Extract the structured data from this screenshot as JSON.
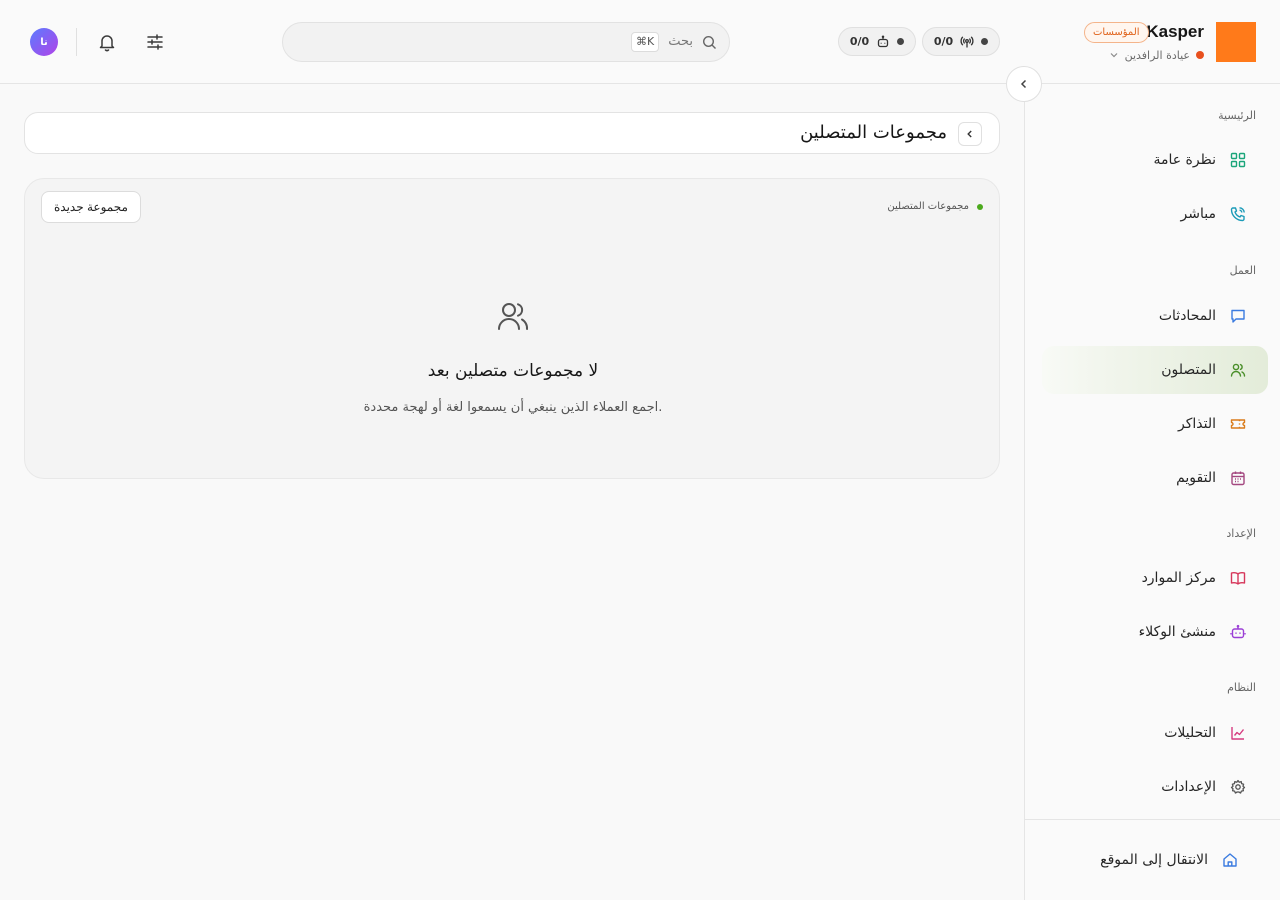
{
  "header": {
    "brand_name": "Kasper",
    "brand_badge": "المؤسسات",
    "clinic_name": "عيادة الرافدين",
    "signal_count": "0/0",
    "bot_count": "0/0",
    "search_placeholder": "بحث",
    "search_shortcut": "⌘K",
    "avatar_initials": "نا",
    "colors": {
      "brand": "#ff7a1a",
      "clinic_status": "#e8501e"
    }
  },
  "sidebar": {
    "sections": {
      "home": "الرئيسية",
      "work": "العمل",
      "setup": "الإعداد",
      "system": "النظام"
    },
    "items": [
      {
        "label": "نظرة عامة",
        "icon": "dashboard-icon",
        "color": "#1aa57a"
      },
      {
        "label": "مباشر",
        "icon": "phone-call-icon",
        "color": "#1b9bb8"
      },
      {
        "label": "المحادثات",
        "icon": "chat-icon",
        "color": "#3a7be0"
      },
      {
        "label": "المتصلون",
        "icon": "users-icon",
        "color": "#4a8f2a",
        "active": true
      },
      {
        "label": "التذاكر",
        "icon": "ticket-icon",
        "color": "#d97b1a"
      },
      {
        "label": "التقويم",
        "icon": "calendar-icon",
        "color": "#a3477f"
      },
      {
        "label": "مركز الموارد",
        "icon": "book-icon",
        "color": "#d6365a"
      },
      {
        "label": "منشئ الوكلاء",
        "icon": "bot-icon",
        "color": "#9b3fd6"
      },
      {
        "label": "التحليلات",
        "icon": "chart-icon",
        "color": "#d63a7f"
      },
      {
        "label": "الإعدادات",
        "icon": "gear-icon",
        "color": "#555555"
      }
    ],
    "bottom_item": {
      "label": "الانتقال إلى الموقع",
      "icon": "home-icon",
      "color": "#3a7be0"
    }
  },
  "main": {
    "page_title": "مجموعات المتصلين",
    "card": {
      "status_label": "مجموعات المتصلين",
      "new_group_button": "مجموعة جديدة",
      "empty_title": "لا مجموعات متصلين بعد",
      "empty_description": "اجمع العملاء الذين ينبغي أن يسمعوا لغة أو لهجة محددة."
    }
  }
}
